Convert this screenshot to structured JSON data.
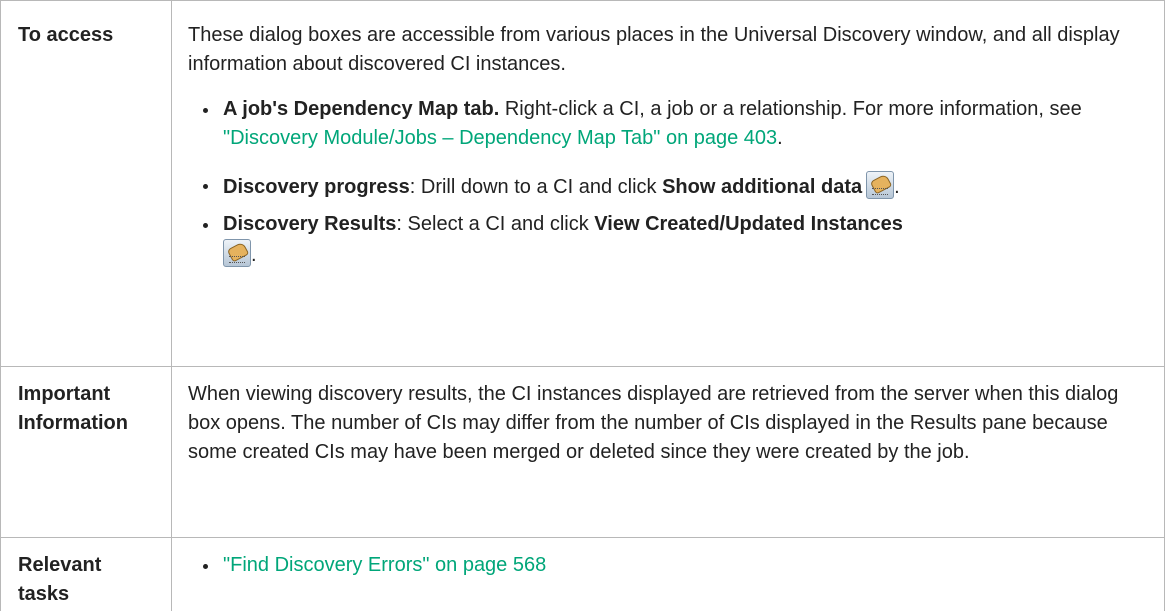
{
  "rows": {
    "access": {
      "header": "To access",
      "intro": "These dialog boxes are accessible from various places in the Universal Discovery window, and all display information about discovered CI instances.",
      "bullets": {
        "map": {
          "bold": "A job's Dependency Map tab.",
          "text": " Right-click a CI, a job or a relationship. For more information, see ",
          "link": "\"Discovery Module/Jobs – Dependency Map Tab\" on page 403",
          "tail": "."
        },
        "progress": {
          "bold": "Discovery progress",
          "text": ": Drill down to a CI and click ",
          "action": "Show additional data",
          "tail": "."
        },
        "results": {
          "bold": "Discovery Results",
          "text": ": Select a CI and click ",
          "action": "View Created/Updated Instances",
          "tail": "."
        }
      },
      "icon": "show-additional-data-icon"
    },
    "important": {
      "header_line1": "Important",
      "header_line2": "Information",
      "body": "When viewing discovery results, the CI instances displayed are retrieved from the server when this dialog box opens. The number of CIs may differ from the number of CIs displayed in the Results pane because some created CIs may have been merged or deleted since they were created by the job."
    },
    "tasks": {
      "header_line1": "Relevant",
      "header_line2": "tasks",
      "link": "\"Find Discovery Errors\" on page 568"
    }
  },
  "colors": {
    "link": "#00a679",
    "border": "#b8b8b8",
    "text": "#222222"
  }
}
